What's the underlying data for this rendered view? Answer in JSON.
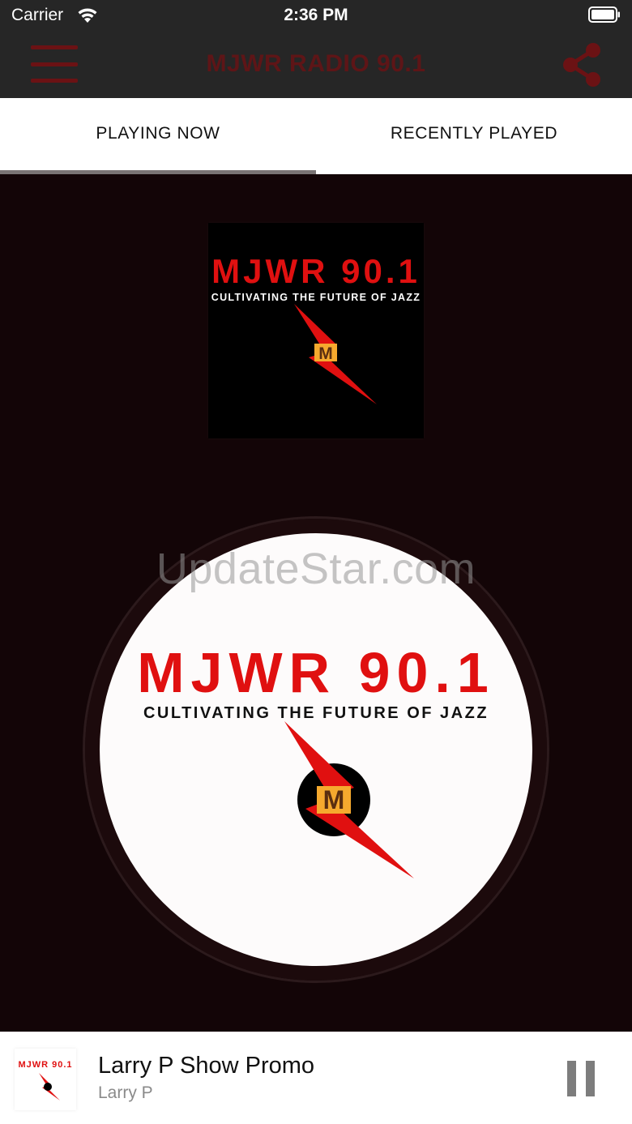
{
  "status_bar": {
    "carrier": "Carrier",
    "time": "2:36 PM"
  },
  "nav": {
    "title": "MJWR RADIO 90.1",
    "menu_icon": "hamburger-menu-icon",
    "share_icon": "share-icon"
  },
  "tabs": [
    {
      "label": "PLAYING NOW",
      "active": true
    },
    {
      "label": "RECENTLY PLAYED",
      "active": false
    }
  ],
  "artwork": {
    "station_name": "MJWR 90.1",
    "tagline": "CULTIVATING THE FUTURE OF JAZZ",
    "logo_letter": "M"
  },
  "watermark": "UpdateStar.com",
  "now_playing": {
    "title": "Larry P Show Promo",
    "artist": "Larry P",
    "pause_icon": "pause-icon"
  },
  "colors": {
    "brand_red": "#e01010",
    "background_dark": "#130507",
    "nav_title": "#5e1517",
    "tab_indicator": "#7a7474"
  }
}
